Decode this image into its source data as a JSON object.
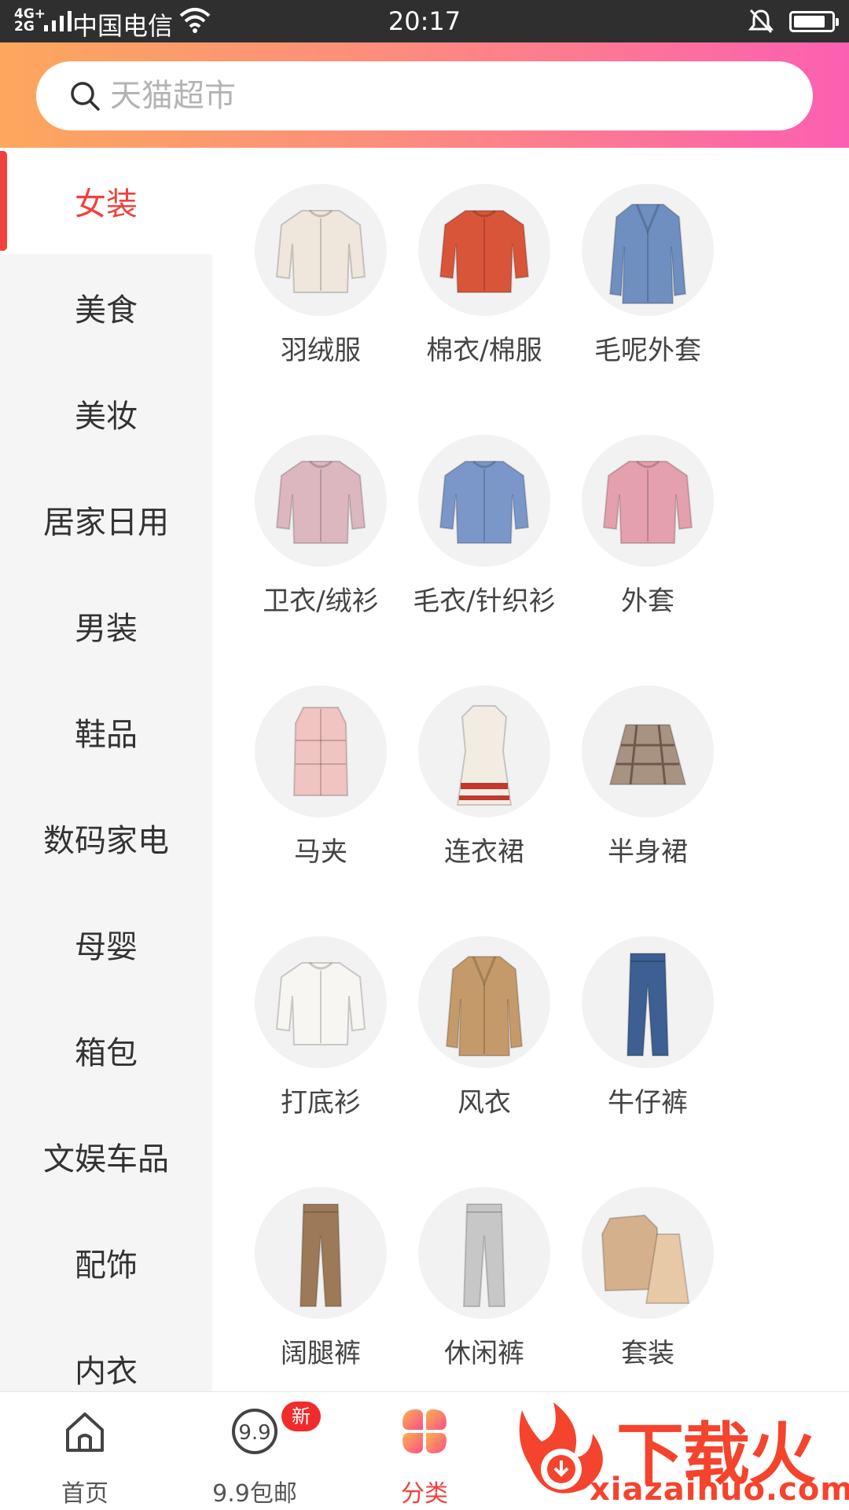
{
  "status_bar": {
    "network": "4G+\n2G",
    "carrier": "中国电信",
    "time": "20:17",
    "battery_percent": 85
  },
  "search": {
    "placeholder": "天猫超市"
  },
  "sidebar": {
    "active_index": 0,
    "items": [
      {
        "label": "女装"
      },
      {
        "label": "美食"
      },
      {
        "label": "美妆"
      },
      {
        "label": "居家日用"
      },
      {
        "label": "男装"
      },
      {
        "label": "鞋品"
      },
      {
        "label": "数码家电"
      },
      {
        "label": "母婴"
      },
      {
        "label": "箱包"
      },
      {
        "label": "文娱车品"
      },
      {
        "label": "配饰"
      },
      {
        "label": "内衣"
      }
    ]
  },
  "categories": [
    {
      "label": "羽绒服",
      "icon": "down-jacket-icon",
      "color": "#efe6dc"
    },
    {
      "label": "棉衣/棉服",
      "icon": "padded-coat-icon",
      "color": "#d9553a"
    },
    {
      "label": "毛呢外套",
      "icon": "wool-coat-icon",
      "color": "#6e8fc0"
    },
    {
      "label": "卫衣/绒衫",
      "icon": "sweatshirt-icon",
      "color": "#dcb7c0"
    },
    {
      "label": "毛衣/针织衫",
      "icon": "sweater-icon",
      "color": "#7b97c9"
    },
    {
      "label": "外套",
      "icon": "leather-jacket-icon",
      "color": "#e4a0ad"
    },
    {
      "label": "马夹",
      "icon": "vest-icon",
      "color": "#efc4c1"
    },
    {
      "label": "连衣裙",
      "icon": "dress-icon",
      "color": "#f3ece3"
    },
    {
      "label": "半身裙",
      "icon": "plaid-skirt-icon",
      "color": "#a89282"
    },
    {
      "label": "打底衫",
      "icon": "turtleneck-icon",
      "color": "#f7f6f2"
    },
    {
      "label": "风衣",
      "icon": "trench-coat-icon",
      "color": "#c59a6a"
    },
    {
      "label": "牛仔裤",
      "icon": "jeans-icon",
      "color": "#3d5f92"
    },
    {
      "label": "阔腿裤",
      "icon": "wide-pants-icon",
      "color": "#9c7a58"
    },
    {
      "label": "休闲裤",
      "icon": "casual-pants-icon",
      "color": "#c7c7c7"
    },
    {
      "label": "套装",
      "icon": "suit-set-icon",
      "color": "#d5b08c"
    }
  ],
  "tabbar": {
    "active_index": 2,
    "tabs": [
      {
        "label": "首页",
        "icon": "home-icon"
      },
      {
        "label": "9.9包邮",
        "icon": "nine-nine-icon",
        "badge": "新"
      },
      {
        "label": "分类",
        "icon": "category-flower-icon"
      }
    ]
  },
  "watermark": {
    "text": "下载火",
    "url": "xiazaihuo.com"
  },
  "colors": {
    "accent": "#f0413c",
    "header_start": "#fca75d",
    "header_end": "#fc5fb1",
    "sidebar_bg": "#f5f5f5"
  }
}
